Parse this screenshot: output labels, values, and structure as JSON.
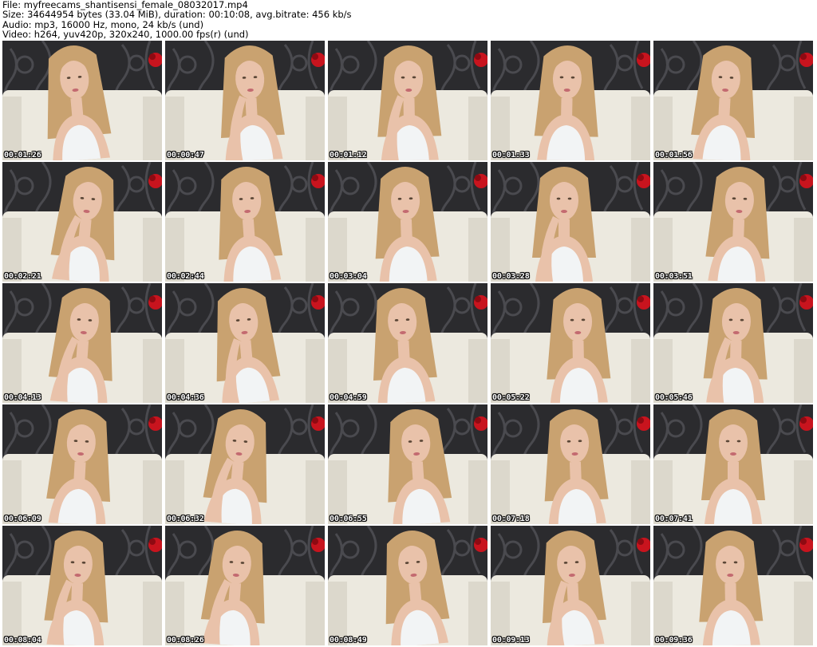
{
  "header": {
    "file_line": "File: myfreecams_shantisensi_female_08032017.mp4",
    "size_line": "Size: 34644954 bytes (33.04 MiB), duration: 00:10:08, avg.bitrate: 456 kb/s",
    "audio_line": "Audio: mp3, 16000 Hz, mono, 24 kb/s (und)",
    "video_line": "Video: h264, yuv420p, 320x240, 1000.00 fps(r) (und)"
  },
  "thumbnails": [
    {
      "timestamp": "00:01:26"
    },
    {
      "timestamp": "00:00:47"
    },
    {
      "timestamp": "00:01:12"
    },
    {
      "timestamp": "00:01:33"
    },
    {
      "timestamp": "00:01:56"
    },
    {
      "timestamp": "00:02:21"
    },
    {
      "timestamp": "00:02:44"
    },
    {
      "timestamp": "00:03:04"
    },
    {
      "timestamp": "00:03:28"
    },
    {
      "timestamp": "00:03:51"
    },
    {
      "timestamp": "00:04:13"
    },
    {
      "timestamp": "00:04:36"
    },
    {
      "timestamp": "00:04:59"
    },
    {
      "timestamp": "00:05:22"
    },
    {
      "timestamp": "00:05:46"
    },
    {
      "timestamp": "00:06:09"
    },
    {
      "timestamp": "00:06:32"
    },
    {
      "timestamp": "00:06:55"
    },
    {
      "timestamp": "00:07:18"
    },
    {
      "timestamp": "00:07:41"
    },
    {
      "timestamp": "00:08:04"
    },
    {
      "timestamp": "00:08:26"
    },
    {
      "timestamp": "00:08:49"
    },
    {
      "timestamp": "00:09:13"
    },
    {
      "timestamp": "00:09:36"
    }
  ],
  "colors": {
    "wallpaper": "#2b2b2e",
    "wallpaper_pattern": "#4a4a4f",
    "sofa": "#ece9df",
    "rose": "#c8141e",
    "skin": "#e9c2aa",
    "hair": "#c9a270",
    "top": "#f2f4f5"
  }
}
